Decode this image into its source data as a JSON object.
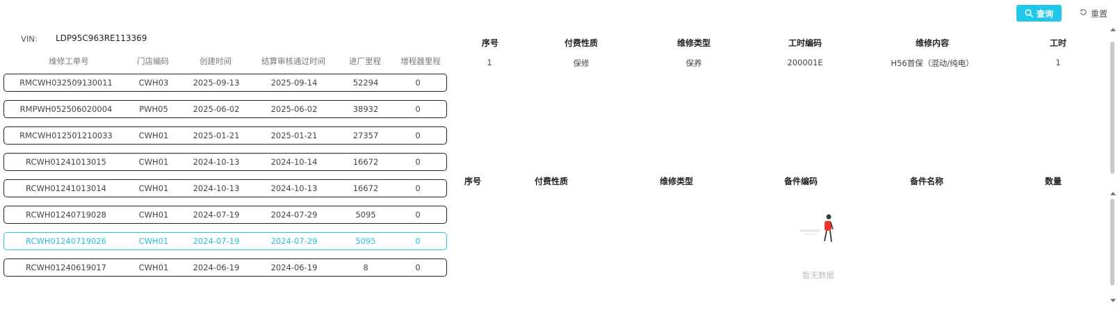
{
  "toolbar": {
    "query_label": "查询",
    "reset_label": "重置",
    "accent_color": "#1fc8e8"
  },
  "vin": {
    "label": "VIN:",
    "value": "LDP95C963RE113369"
  },
  "orders": {
    "columns": [
      "维修工单号",
      "门店编码",
      "创建时间",
      "结算审核通过时间",
      "进厂里程",
      "增程器里程"
    ],
    "rows": [
      {
        "order_no": "RMCWH032509130011",
        "store": "CWH03",
        "created": "2025-09-13",
        "settled": "2025-09-14",
        "mileage": "52294",
        "ext_mileage": "0"
      },
      {
        "order_no": "RMPWH052506020004",
        "store": "PWH05",
        "created": "2025-06-02",
        "settled": "2025-06-02",
        "mileage": "38932",
        "ext_mileage": "0"
      },
      {
        "order_no": "RMCWH012501210033",
        "store": "CWH01",
        "created": "2025-01-21",
        "settled": "2025-01-21",
        "mileage": "27357",
        "ext_mileage": "0"
      },
      {
        "order_no": "RCWH01241013015",
        "store": "CWH01",
        "created": "2024-10-13",
        "settled": "2024-10-14",
        "mileage": "16672",
        "ext_mileage": "0"
      },
      {
        "order_no": "RCWH01241013014",
        "store": "CWH01",
        "created": "2024-10-13",
        "settled": "2024-10-13",
        "mileage": "16672",
        "ext_mileage": "0"
      },
      {
        "order_no": "RCWH01240719028",
        "store": "CWH01",
        "created": "2024-07-19",
        "settled": "2024-07-29",
        "mileage": "5095",
        "ext_mileage": "0"
      },
      {
        "order_no": "RCWH01240719026",
        "store": "CWH01",
        "created": "2024-07-19",
        "settled": "2024-07-29",
        "mileage": "5095",
        "ext_mileage": "0"
      },
      {
        "order_no": "RCWH01240619017",
        "store": "CWH01",
        "created": "2024-06-19",
        "settled": "2024-06-19",
        "mileage": "8",
        "ext_mileage": "0"
      }
    ],
    "selected_index": 6,
    "selected_color": "#22c0dc"
  },
  "labor": {
    "columns": [
      "序号",
      "付费性质",
      "维修类型",
      "工时编码",
      "维修内容",
      "工时"
    ],
    "rows": [
      {
        "seq": "1",
        "pay_type": "保修",
        "repair_type": "保养",
        "code": "200001E",
        "content": "H56首保（混动/纯电）",
        "hours": "1"
      }
    ]
  },
  "parts": {
    "columns": [
      "序号",
      "付费性质",
      "维修类型",
      "备件编码",
      "备件名称",
      "数量"
    ],
    "rows": [],
    "empty_text": "暂无数据"
  }
}
